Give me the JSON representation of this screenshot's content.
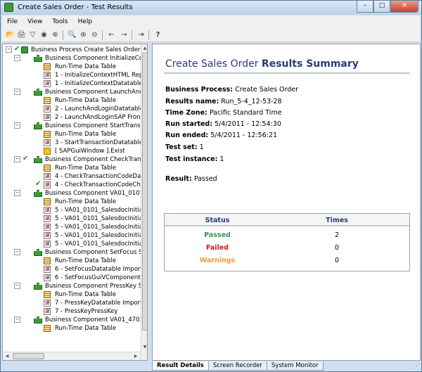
{
  "window": {
    "title": "Create Sales Order - Test Results",
    "minimize": "–",
    "maximize": "□",
    "close": "✕"
  },
  "menu": {
    "file": "File",
    "view": "View",
    "tools": "Tools",
    "help": "Help"
  },
  "toolbar": {
    "open": "📂",
    "print": "🖨",
    "filter": "▽",
    "report": "◉",
    "export": "⊕",
    "find": "🔍",
    "zoom_in": "⊕",
    "zoom_out": "⊖",
    "back": "←",
    "forward": "→",
    "go": "⇥",
    "help": "?"
  },
  "tree": {
    "expander_minus": "−",
    "checkmark": "✔",
    "rows": [
      {
        "label": "Business Process Create Sales Order S"
      },
      {
        "label": "Business Component InitializeCon"
      },
      {
        "label": "Run-Time Data Table"
      },
      {
        "label": "1 - InitializeContextHTML Rep"
      },
      {
        "label": "1 - InitializeContextDatatable I"
      },
      {
        "label": "Business Component LaunchAnd"
      },
      {
        "label": "Run-Time Data Table"
      },
      {
        "label": "2 - LaunchAndLoginDatatable"
      },
      {
        "label": "2 - LaunchAndLoginSAP Fron"
      },
      {
        "label": "Business Component StartTransa"
      },
      {
        "label": "Run-Time Data Table"
      },
      {
        "label": "3 - StartTransactionDatatable"
      },
      {
        "label": "[ SAPGuiWindow ].Exist"
      },
      {
        "label": "Business Component CheckTrans"
      },
      {
        "label": "Run-Time Data Table"
      },
      {
        "label": "4 - CheckTransactionCodeDat"
      },
      {
        "label": "4 - CheckTransactionCodeCh"
      },
      {
        "label": "Business Component VA01_0101_"
      },
      {
        "label": "Run-Time Data Table"
      },
      {
        "label": "5 - VA01_0101_SalesdocInitials"
      },
      {
        "label": "5 - VA01_0101_SalesdocInitials"
      },
      {
        "label": "5 - VA01_0101_SalesdocInitials"
      },
      {
        "label": "5 - VA01_0101_SalesdocInitials"
      },
      {
        "label": "5 - VA01_0101_SalesdocInitials"
      },
      {
        "label": "Business Component SetFocus Su"
      },
      {
        "label": "Run-Time Data Table"
      },
      {
        "label": "6 - SetFocusDatatable Import"
      },
      {
        "label": "6 - SetFocusGuiVComponent_"
      },
      {
        "label": "Business Component PressKey Su"
      },
      {
        "label": "Run-Time Data Table"
      },
      {
        "label": "7 - PressKeyDatatable Import"
      },
      {
        "label": "7 - PressKeyPressKey"
      },
      {
        "label": "Business Component VA01_4701_"
      },
      {
        "label": "Run-Time Data Table"
      }
    ]
  },
  "results": {
    "title_prefix": "Create Sales Order",
    "title_suffix": "Results Summary",
    "business_process_label": "Business Process:",
    "business_process": "Create Sales Order",
    "results_name_label": "Results name:",
    "results_name": "Run_5-4_12-53-28",
    "time_zone_label": "Time Zone:",
    "time_zone": "Pacific Standard Time",
    "run_started_label": "Run started:",
    "run_started": "5/4/2011 - 12:54:30",
    "run_ended_label": "Run ended:",
    "run_ended": "5/4/2011 - 12:56:21",
    "test_set_label": "Test set:",
    "test_set": "1",
    "test_instance_label": "Test instance:",
    "test_instance": "1",
    "result_label": "Result:",
    "result": "Passed"
  },
  "status_table": {
    "col_status": "Status",
    "col_times": "Times",
    "passed_label": "Passed",
    "passed_times": "2",
    "failed_label": "Failed",
    "failed_times": "0",
    "warnings_label": "Warnings",
    "warnings_times": "0"
  },
  "tabs": {
    "result_details": "Result Details",
    "screen_recorder": "Screen Recorder",
    "system_monitor": "System Monitor"
  }
}
